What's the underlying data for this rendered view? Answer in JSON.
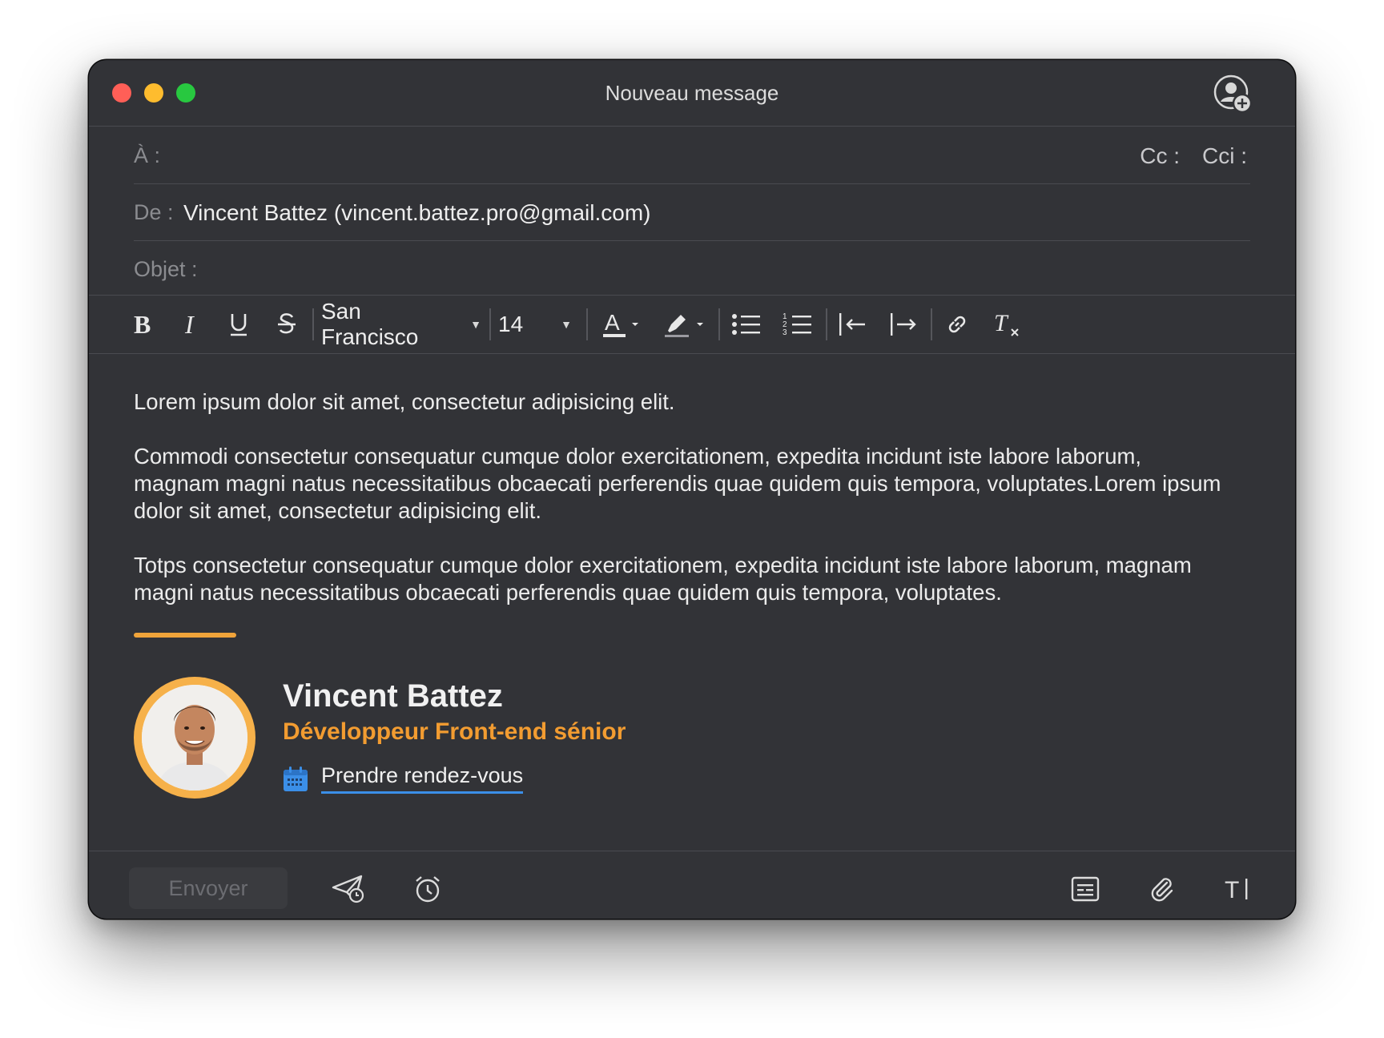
{
  "window": {
    "title": "Nouveau message"
  },
  "header": {
    "to_label": "À :",
    "cc_label": "Cc :",
    "cci_label": "Cci :",
    "from_label": "De :",
    "from_value": "Vincent Battez (vincent.battez.pro@gmail.com)",
    "subject_label": "Objet :"
  },
  "toolbar": {
    "font_name": "San Francisco",
    "font_size": "14",
    "icons": [
      "bold-icon",
      "italic-icon",
      "underline-icon",
      "strikethrough-icon",
      "text-color-icon",
      "highlight-icon",
      "bullet-list-icon",
      "numbered-list-icon",
      "outdent-icon",
      "indent-icon",
      "link-icon",
      "clear-format-icon"
    ]
  },
  "body": {
    "paragraphs": [
      "Lorem ipsum dolor sit amet, consectetur adipisicing elit.",
      "Commodi consectetur consequatur cumque dolor exercitationem, expedita incidunt iste labore laborum, magnam magni natus necessitatibus obcaecati perferendis quae quidem quis tempora, voluptates.Lorem ipsum dolor sit amet, consectetur adipisicing elit.",
      "Totps consectetur consequatur cumque dolor exercitationem, expedita incidunt iste labore laborum, magnam magni natus necessitatibus obcaecati perferendis quae quidem quis tempora, voluptates."
    ]
  },
  "signature": {
    "name": "Vincent Battez",
    "role": "Développeur Front-end sénior",
    "link_text": "Prendre rendez-vous",
    "accent_color": "#f29c31",
    "link_color": "#3b8fe8"
  },
  "footer": {
    "send_label": "Envoyer",
    "icons": [
      "send-later-icon",
      "alarm-icon",
      "template-icon",
      "attachment-icon",
      "text-format-icon"
    ]
  },
  "colors": {
    "window_bg": "#323337",
    "traffic_red": "#ff5f57",
    "traffic_yellow": "#febc2e",
    "traffic_green": "#28c840"
  }
}
